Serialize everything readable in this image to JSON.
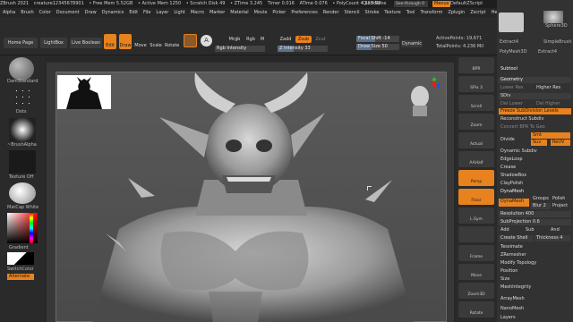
{
  "infobar": {
    "app": "ZBrush 2021",
    "file": "creature12345678901",
    "free_mem": "• Free Mem 5.52GB",
    "active_mem": "• Active Mem 1250",
    "scratch": "• Scratch Disk 49",
    "ztime": "• ZTime 3.245",
    "timer": "Timer 0.016",
    "atime": "ATime 0.076",
    "polycount": "• PolyCount 4.263 MP",
    "quicksave": "QuickSave",
    "seethrough": "See-through 0",
    "menus": "Menus",
    "default_zscript": "DefaultZScript"
  },
  "menubar": {
    "items": [
      "Alpha",
      "Brush",
      "Color",
      "Document",
      "Draw",
      "Dynamics",
      "Edit",
      "File",
      "Layer",
      "Light",
      "Macro",
      "Marker",
      "Material",
      "Movie",
      "Picker",
      "Preferences",
      "Render",
      "Stencil",
      "Stroke",
      "Texture",
      "Tool",
      "Transform",
      "Zplugin",
      "Zscript",
      "Help"
    ]
  },
  "toolbar": {
    "home": "Home Page",
    "lightbox": "LightBox",
    "live_boolean": "Live Boolean",
    "edit": "Edit",
    "draw": "Draw",
    "move": "Move",
    "scale": "Scale",
    "rotate": "Rotate",
    "a_label": "A",
    "mrgb": "Mrgb",
    "rgb": "Rgb",
    "m": "M",
    "rgb_intensity": "Rgb Intensity",
    "zadd": "Zadd",
    "zsub": "Zsub",
    "zcut": "Zcut",
    "z_intensity": "Z Intensity 33",
    "focal_shift": "Focal Shift -14",
    "draw_size": "Draw Size 50",
    "dynamic": "Dynamic",
    "active_points": "ActivePoints: 19,671",
    "total_points": "TotalPoints: 4.236 Mil",
    "z_intensity_level": 0.33,
    "focal_shift_level": 0.43,
    "draw_size_level": 0.35
  },
  "leftshelf": {
    "brush": "DamStandard",
    "stroke": "Dots",
    "alpha": "~BrushAlpha",
    "texture": "Texture Off",
    "material": "MatCap White",
    "gradient": "Gradient",
    "switch_color": "SwitchColor",
    "alternate": "Alternate"
  },
  "rightshelf": {
    "items": [
      "BPR",
      "SPix 3",
      "Scroll",
      "Zoom",
      "Actual",
      "AAHalf",
      "Persp",
      "Floor",
      "L.Sym",
      "",
      "Frame",
      "Move",
      "Zoom3D",
      "Rotate"
    ]
  },
  "tray": {
    "subtool_label": "Subtool",
    "top_tools": [
      "Extract4",
      "Sphere3D",
      "SimpleBrush",
      "PolyMesh3D",
      "Extract4"
    ],
    "geometry": "Geometry",
    "lower_res": "Lower Res",
    "higher_res": "Higher Res",
    "sdiv": "SDiv",
    "del_lower": "Del Lower",
    "del_higher": "Del Higher",
    "freeze": "Freeze SubDivision Levels",
    "reconstruct": "Reconstruct Subdiv",
    "convert_bpr": "Convert BPR To Geo",
    "divide": "Divide",
    "smt": "Smt",
    "suv": "Suv",
    "rsmt": "ReUV",
    "dynamic_subdiv": "Dynamic Subdiv",
    "edgeloop": "EdgeLoop",
    "crease": "Crease",
    "shadowbox": "ShadowBox",
    "claypolish": "ClayPolish",
    "dynamesh_head": "DynaMesh",
    "dynamesh_btn": "DynaMesh",
    "groups": "Groups",
    "polish": "Polish",
    "blur": "Blur 2",
    "project": "Project",
    "resolution": "Resolution 400",
    "subprojection": "SubProjection 0.6",
    "add": "Add",
    "sub": "Sub",
    "and": "And",
    "create_shell": "Create Shell",
    "thickness": "Thickness 4",
    "tessimate": "Tessimate",
    "zremesher": "ZRemesher",
    "modify_topology": "Modify Topology",
    "position": "Position",
    "size": "Size",
    "meshintegrity": "MeshIntegrity",
    "arraymesh": "ArrayMesh",
    "nanomesh": "NanoMesh",
    "layers": "Layers"
  },
  "colors": {
    "accent": "#e8821e",
    "panel": "#2a2a2a",
    "tray": "#323232"
  }
}
